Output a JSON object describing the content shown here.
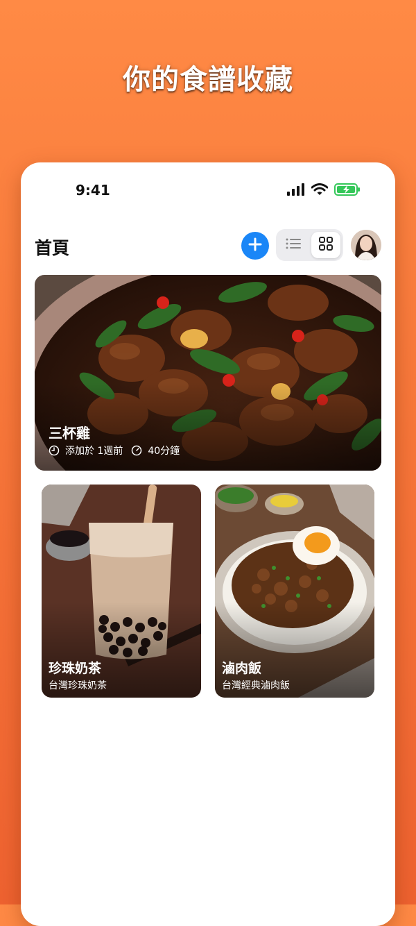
{
  "headline": "你的食譜收藏",
  "status_bar": {
    "time": "9:41"
  },
  "header": {
    "title": "首頁"
  },
  "icons": {
    "add": "plus-icon",
    "list": "list-view-icon",
    "grid": "grid-view-icon",
    "clock": "clock-icon",
    "timer": "timer-icon"
  },
  "colors": {
    "accent": "#1a86f7",
    "background": "#f7773a",
    "battery": "#34c759"
  },
  "recipes": [
    {
      "title": "三杯雞",
      "added": "添加於 1週前",
      "duration": "40分鐘"
    },
    {
      "title": "珍珠奶茶",
      "subtitle": "台灣珍珠奶茶"
    },
    {
      "title": "滷肉飯",
      "subtitle": "台灣經典滷肉飯"
    }
  ]
}
